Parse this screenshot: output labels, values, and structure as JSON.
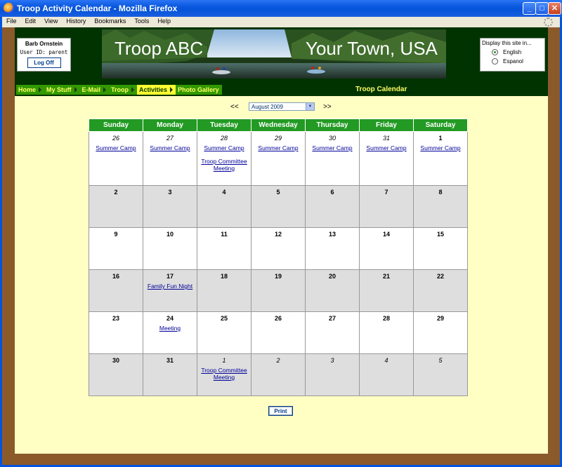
{
  "window": {
    "title": "Troop Activity Calendar - Mozilla Firefox",
    "menu": [
      "File",
      "Edit",
      "View",
      "History",
      "Bookmarks",
      "Tools",
      "Help"
    ]
  },
  "user": {
    "name": "Barb Ornstein",
    "id_label": "User ID:  parent",
    "logoff_label": "Log Off"
  },
  "banner": {
    "left_text": "Troop ABC",
    "right_text": "Your Town, USA"
  },
  "language": {
    "title": "Display this site in...",
    "options": [
      {
        "label": "English",
        "selected": true
      },
      {
        "label": "Espanol",
        "selected": false
      }
    ]
  },
  "nav": {
    "items": [
      {
        "label": "Home",
        "active": false
      },
      {
        "label": "My Stuff",
        "active": false
      },
      {
        "label": "E-Mail",
        "active": false
      },
      {
        "label": "Troop",
        "active": false
      },
      {
        "label": "Activities",
        "active": true
      },
      {
        "label": "Photo Gallery",
        "active": false
      }
    ],
    "page_title": "Troop Calendar"
  },
  "calendar": {
    "prev": "<<",
    "next": ">>",
    "month": "August 2009",
    "day_headers": [
      "Sunday",
      "Monday",
      "Tuesday",
      "Wednesday",
      "Thursday",
      "Friday",
      "Saturday"
    ],
    "weeks": [
      [
        {
          "day": "26",
          "current": false,
          "events": [
            "Summer Camp"
          ]
        },
        {
          "day": "27",
          "current": false,
          "events": [
            "Summer Camp"
          ]
        },
        {
          "day": "28",
          "current": false,
          "events": [
            "Summer Camp",
            "Troop Committee Meeting"
          ]
        },
        {
          "day": "29",
          "current": false,
          "events": [
            "Summer Camp"
          ]
        },
        {
          "day": "30",
          "current": false,
          "events": [
            "Summer Camp"
          ]
        },
        {
          "day": "31",
          "current": false,
          "events": [
            "Summer Camp"
          ]
        },
        {
          "day": "1",
          "current": true,
          "events": [
            "Summer Camp"
          ]
        }
      ],
      [
        {
          "day": "2",
          "current": true,
          "events": []
        },
        {
          "day": "3",
          "current": true,
          "events": []
        },
        {
          "day": "4",
          "current": true,
          "events": []
        },
        {
          "day": "5",
          "current": true,
          "events": []
        },
        {
          "day": "6",
          "current": true,
          "events": []
        },
        {
          "day": "7",
          "current": true,
          "events": []
        },
        {
          "day": "8",
          "current": true,
          "events": []
        }
      ],
      [
        {
          "day": "9",
          "current": true,
          "events": []
        },
        {
          "day": "10",
          "current": true,
          "events": []
        },
        {
          "day": "11",
          "current": true,
          "events": []
        },
        {
          "day": "12",
          "current": true,
          "events": []
        },
        {
          "day": "13",
          "current": true,
          "events": []
        },
        {
          "day": "14",
          "current": true,
          "events": []
        },
        {
          "day": "15",
          "current": true,
          "events": []
        }
      ],
      [
        {
          "day": "16",
          "current": true,
          "events": []
        },
        {
          "day": "17",
          "current": true,
          "events": [
            "Family Fun Night"
          ]
        },
        {
          "day": "18",
          "current": true,
          "events": []
        },
        {
          "day": "19",
          "current": true,
          "events": []
        },
        {
          "day": "20",
          "current": true,
          "events": []
        },
        {
          "day": "21",
          "current": true,
          "events": []
        },
        {
          "day": "22",
          "current": true,
          "events": []
        }
      ],
      [
        {
          "day": "23",
          "current": true,
          "events": []
        },
        {
          "day": "24",
          "current": true,
          "events": [
            "Meeting"
          ]
        },
        {
          "day": "25",
          "current": true,
          "events": []
        },
        {
          "day": "26",
          "current": true,
          "events": []
        },
        {
          "day": "27",
          "current": true,
          "events": []
        },
        {
          "day": "28",
          "current": true,
          "events": []
        },
        {
          "day": "29",
          "current": true,
          "events": []
        }
      ],
      [
        {
          "day": "30",
          "current": true,
          "events": []
        },
        {
          "day": "31",
          "current": true,
          "events": []
        },
        {
          "day": "1",
          "current": false,
          "events": [
            "Troop Committee Meeting"
          ]
        },
        {
          "day": "2",
          "current": false,
          "events": []
        },
        {
          "day": "3",
          "current": false,
          "events": []
        },
        {
          "day": "4",
          "current": false,
          "events": []
        },
        {
          "day": "5",
          "current": false,
          "events": []
        }
      ]
    ],
    "print_label": "Print"
  },
  "colors": {
    "page_bg": "#ffffc4",
    "header_bg": "#003300",
    "nav_bg": "#339900",
    "nav_active_bg": "#ffff33",
    "cal_header_bg": "#239a23",
    "link": "#000099"
  }
}
